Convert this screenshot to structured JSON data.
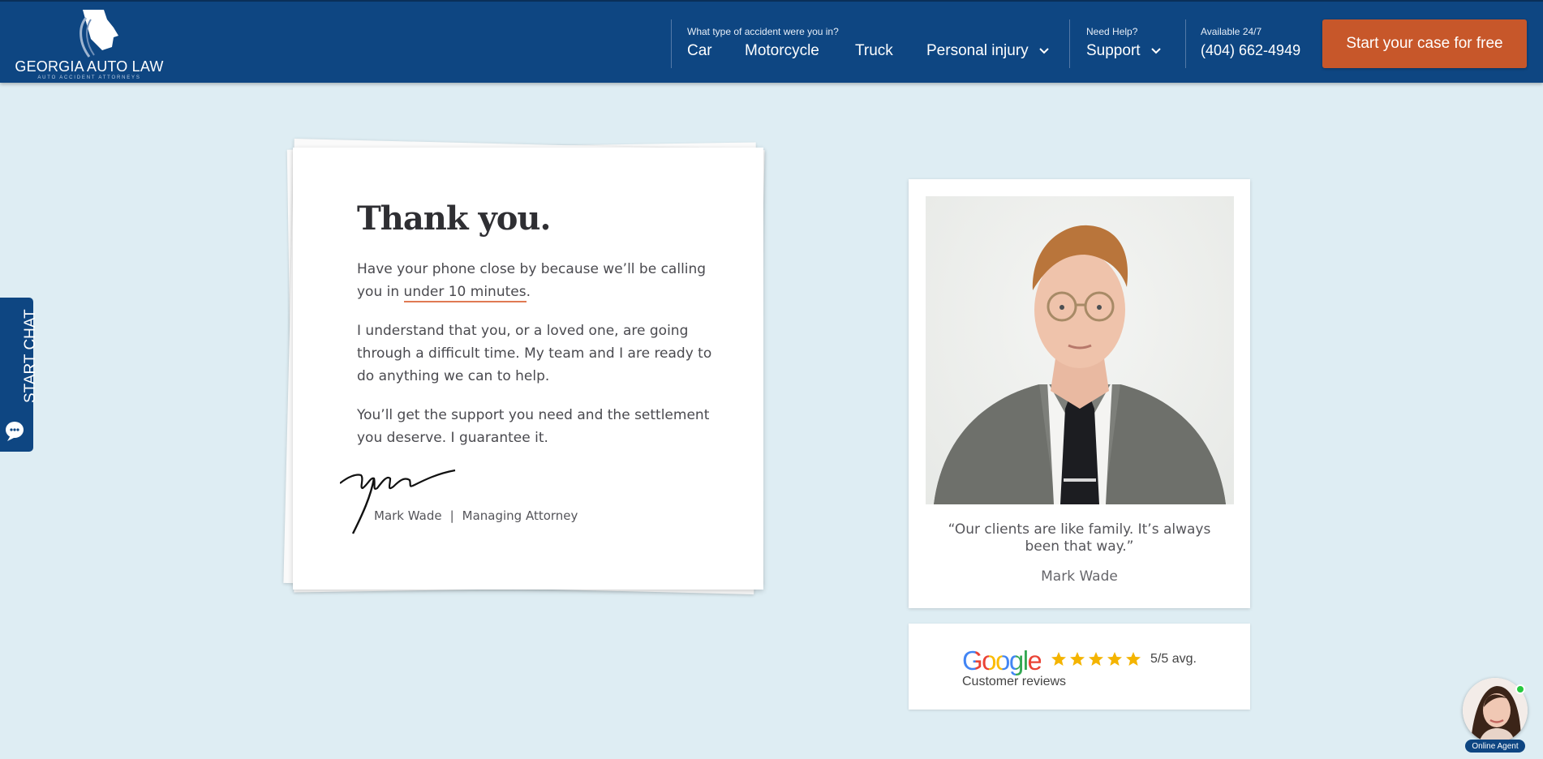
{
  "header": {
    "logo_text": "GEORGIA AUTO LAW",
    "logo_subtext": "AUTO ACCIDENT ATTORNEYS",
    "accident_caption": "What type of accident were you in?",
    "accident_types": [
      "Car",
      "Motorcycle",
      "Truck",
      "Personal injury"
    ],
    "help_caption": "Need Help?",
    "help_label": "Support",
    "phone_caption": "Available 24/7",
    "phone": "(404) 662-4949",
    "cta_label": "Start your case for free"
  },
  "letter": {
    "title": "Thank you.",
    "p1_before": "Have your phone close by because we’ll be calling you in ",
    "p1_highlight": "under 10 minutes",
    "p1_after": ".",
    "p2": "I understand that you, or a loved one, are going through a difficult time. My team and I are ready to do anything we can to help.",
    "p3": "You’ll get the support you need and the settlement you deserve. I guarantee it.",
    "signer_name": "Mark Wade",
    "separator": "|",
    "signer_title": "Managing Attorney"
  },
  "profile": {
    "quote": "“Our clients are like family. It’s always been that way.”",
    "author": "Mark Wade"
  },
  "reviews": {
    "brand": "Google",
    "rating_stars": 5,
    "avg_label": "5/5 avg.",
    "label": "Customer reviews",
    "star_color": "#f4b400"
  },
  "chat": {
    "label": "START CHAT"
  },
  "agent": {
    "label": "Online Agent"
  },
  "colors": {
    "brand_navy": "#0e4682",
    "cta_orange": "#c7572a",
    "page_bg": "#deedf3",
    "highlight_underline": "#e07a53"
  }
}
